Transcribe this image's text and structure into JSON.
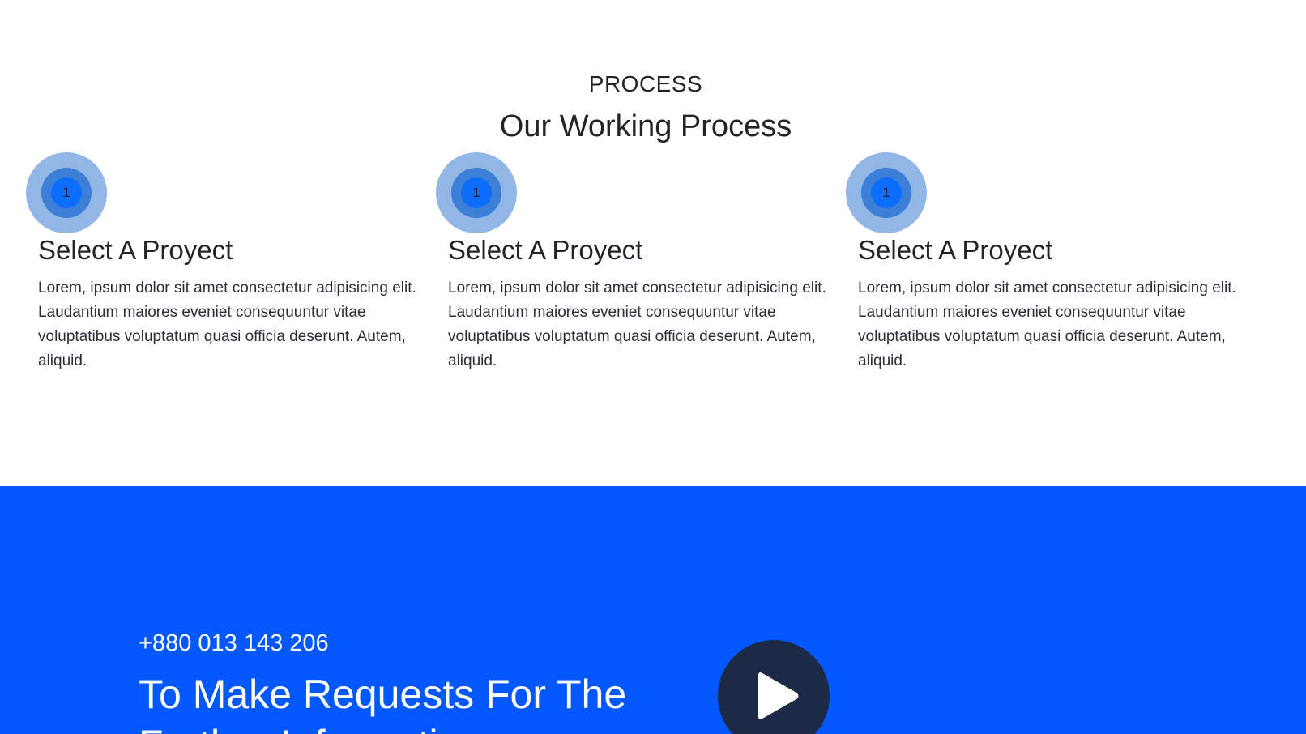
{
  "process": {
    "eyebrow": "PROCESS",
    "title": "Our Working Process",
    "steps": [
      {
        "number": "1",
        "title": "Select A Proyect",
        "text": "Lorem, ipsum dolor sit amet consectetur adipisicing elit. Laudantium maiores eveniet consequuntur vitae voluptatibus voluptatum quasi officia deserunt. Autem, aliquid."
      },
      {
        "number": "1",
        "title": "Select A Proyect",
        "text": "Lorem, ipsum dolor sit amet consectetur adipisicing elit. Laudantium maiores eveniet consequuntur vitae voluptatibus voluptatum quasi officia deserunt. Autem, aliquid."
      },
      {
        "number": "1",
        "title": "Select A Proyect",
        "text": "Lorem, ipsum dolor sit amet consectetur adipisicing elit. Laudantium maiores eveniet consequuntur vitae voluptatibus voluptatum quasi officia deserunt. Autem, aliquid."
      }
    ]
  },
  "cta": {
    "phone": "+880 013 143 206",
    "heading": "To Make Requests For The Further Information",
    "play_icon": "play-icon"
  },
  "colors": {
    "accent": "#0358fd",
    "badge_outer": "#92b7e6",
    "badge_mid": "#3b7fd6",
    "badge_inner": "#0d6efd",
    "play_button": "#1c2a45"
  }
}
